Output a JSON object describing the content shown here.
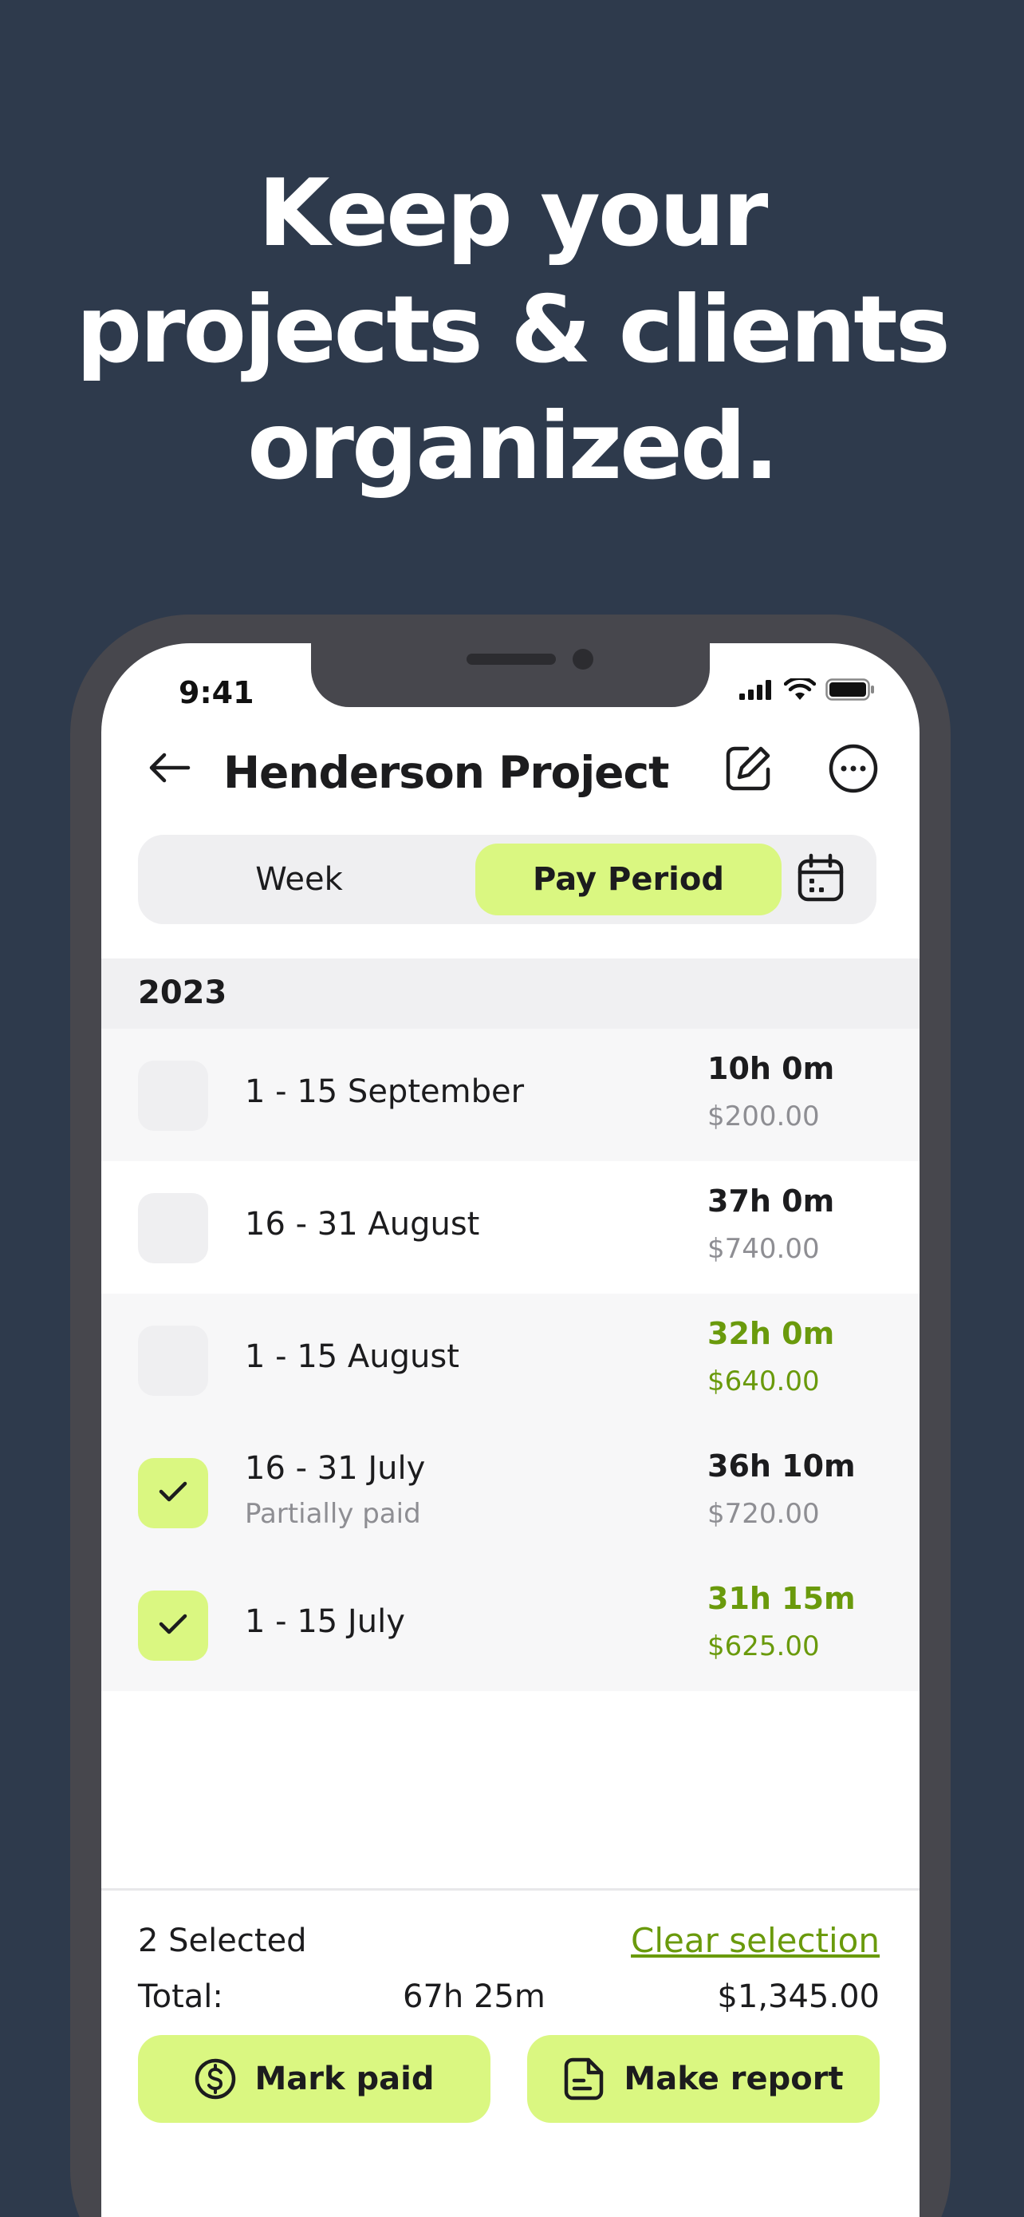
{
  "headline": {
    "line1": "Keep your",
    "line2": "projects & clients",
    "line3": "organized."
  },
  "status_bar": {
    "time": "9:41",
    "icons": [
      "cellular-signal-icon",
      "wifi-icon",
      "battery-icon"
    ]
  },
  "nav": {
    "title": "Henderson Project",
    "back_icon": "arrow-left-icon",
    "edit_icon": "edit-icon",
    "more_icon": "more-icon"
  },
  "segmented": {
    "week_label": "Week",
    "pay_period_label": "Pay Period",
    "selected": "Pay Period",
    "calendar_icon": "calendar-icon"
  },
  "section": {
    "year": "2023"
  },
  "rows": [
    {
      "period": "1 - 15 September",
      "subtitle": "",
      "hours": "10h 0m",
      "amount": "$200.00",
      "checked": false,
      "paid": false
    },
    {
      "period": "16 - 31 August",
      "subtitle": "",
      "hours": "37h 0m",
      "amount": "$740.00",
      "checked": false,
      "paid": false
    },
    {
      "period": "1 - 15 August",
      "subtitle": "",
      "hours": "32h 0m",
      "amount": "$640.00",
      "checked": false,
      "paid": true
    },
    {
      "period": "16 - 31 July",
      "subtitle": "Partially paid",
      "hours": "36h 10m",
      "amount": "$720.00",
      "checked": true,
      "paid": false
    },
    {
      "period": "1 - 15 July",
      "subtitle": "",
      "hours": "31h 15m",
      "amount": "$625.00",
      "checked": true,
      "paid": true
    }
  ],
  "bottom_bar": {
    "selected_count": "2 Selected",
    "clear_selection": "Clear selection",
    "total_label": "Total:",
    "total_hours": "67h 25m",
    "total_amount": "$1,345.00",
    "mark_paid_label": "Mark paid",
    "make_report_label": "Make report"
  },
  "colors": {
    "background": "#2e3a4c",
    "accent": "#daf781",
    "paid_text": "#6a9a0c",
    "phone_frame": "#47474d"
  }
}
